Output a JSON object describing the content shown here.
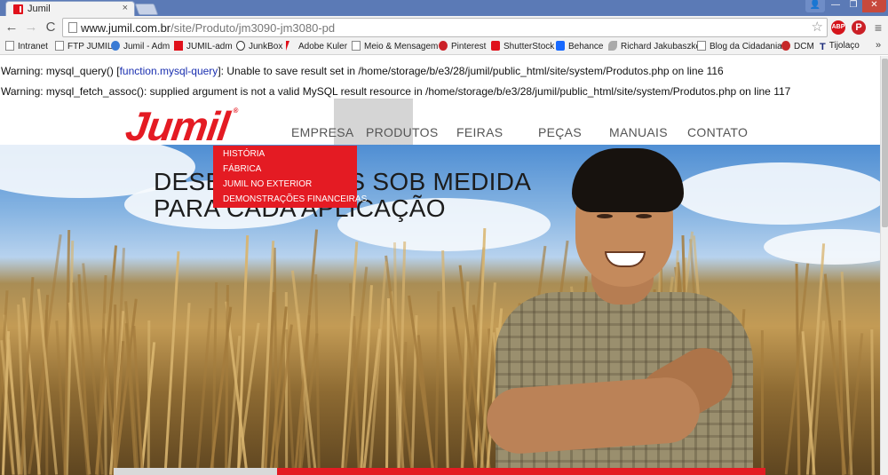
{
  "browser": {
    "tab_title": "Jumil",
    "tab_close": "×",
    "url_host": "www.jumil.com.br",
    "url_path": "/site/Produto/jm3090-jm3080-pd",
    "window_buttons": {
      "user": "👤",
      "minimize": "—",
      "maximize": "❐",
      "close": "✕"
    },
    "nav": {
      "back": "←",
      "forward": "→",
      "reload": "C"
    },
    "star": "☆",
    "extensions": {
      "abp": "ABP",
      "pinterest": "P",
      "menu": "≡"
    }
  },
  "bookmarks": [
    {
      "label": "Intranet",
      "icon": "page-icon"
    },
    {
      "label": "FTP JUMIL",
      "icon": "page-icon"
    },
    {
      "label": "Jumil - Adm",
      "icon": "globe-icon"
    },
    {
      "label": "JUMIL-adm",
      "icon": "jumil-icon"
    },
    {
      "label": "JunkBox",
      "icon": "github-icon"
    },
    {
      "label": "Adobe Kuler",
      "icon": "adobe-icon"
    },
    {
      "label": "Meio & Mensagem",
      "icon": "page-icon"
    },
    {
      "label": "Pinterest",
      "icon": "pinterest-icon"
    },
    {
      "label": "ShutterStock",
      "icon": "shutterstock-icon"
    },
    {
      "label": "Behance",
      "icon": "behance-icon"
    },
    {
      "label": "Richard Jakubaszko",
      "icon": "feather-icon"
    },
    {
      "label": "Blog da Cidadania",
      "icon": "page-icon"
    },
    {
      "label": "DCM",
      "icon": "dcm-icon"
    },
    {
      "label": "Tijolaço",
      "icon": "t-icon"
    }
  ],
  "bookmarks_more": "»",
  "warnings": [
    {
      "prefix": "Warning: mysql_query() [",
      "link": "function.mysql-query",
      "suffix": "]: Unable to save result set in /home/storage/b/e3/28/jumil/public_html/site/system/Produtos.php on line 116"
    },
    {
      "prefix": "Warning: mysql_fetch_assoc(): supplied argument is not a valid MySQL result resource in /home/storage/b/e3/28/jumil/public_html/site/system/Produtos.php on line 117",
      "link": "",
      "suffix": ""
    }
  ],
  "site": {
    "logo": "Jumil",
    "logo_reg": "®",
    "nav": [
      "EMPRESA",
      "PRODUTOS",
      "FEIRAS",
      "PEÇAS",
      "MANUAIS",
      "CONTATO"
    ],
    "dropdown": [
      "HISTÓRIA",
      "FÁBRICA",
      "JUMIL NO EXTERIOR",
      "DEMONSTRAÇÕES FINANCEIRAS"
    ],
    "hero_line1": "DESENVOLVIDAS SOB MEDIDA",
    "hero_line2": "PARA CADA APLICAÇÃO"
  },
  "colors": {
    "brand_red": "#e41b23",
    "nav_text": "#555555",
    "link_blue": "#1a2fb0"
  }
}
